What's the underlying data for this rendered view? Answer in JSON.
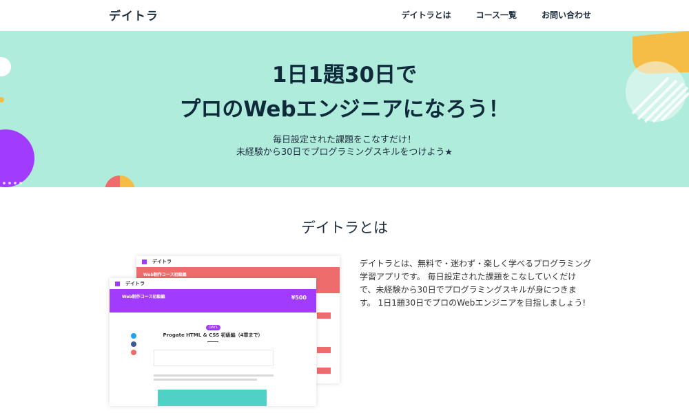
{
  "header": {
    "logo": "デイトラ",
    "nav": [
      "デイトラとは",
      "コース一覧",
      "お問い合わせ"
    ]
  },
  "hero": {
    "title_line1": "1日1題30日で",
    "title_line2": "プロのWebエンジニアになろう！",
    "subtitle_line1": "毎日設定された課題をこなすだけ！",
    "subtitle_line2": "未経験から30日でプログラミングスキルをつけよう★"
  },
  "about": {
    "heading": "デイトラとは",
    "text": "デイトラとは、無料で・迷わず・楽しく学べるプログラミング学習アプリです。 毎日設定された課題をこなしていくだけで、未経験から30日でプログラミングスキルが身につきます。 1日1題30日でプロのWebエンジニアを目指しましょう!"
  },
  "mockup": {
    "logo": "デイトラ",
    "back_banner": "Web制作コース初級編",
    "front_banner": "Web制作コース初級編",
    "front_price": "¥500",
    "badge": "DAY1",
    "lesson_title": "Progate HTML & CSS 初級編（4章まで）"
  },
  "colors": {
    "hero_bg": "#b0ecdc",
    "purple": "#a13cff",
    "coral": "#ef6c6c",
    "yellow": "#f5bd45"
  }
}
